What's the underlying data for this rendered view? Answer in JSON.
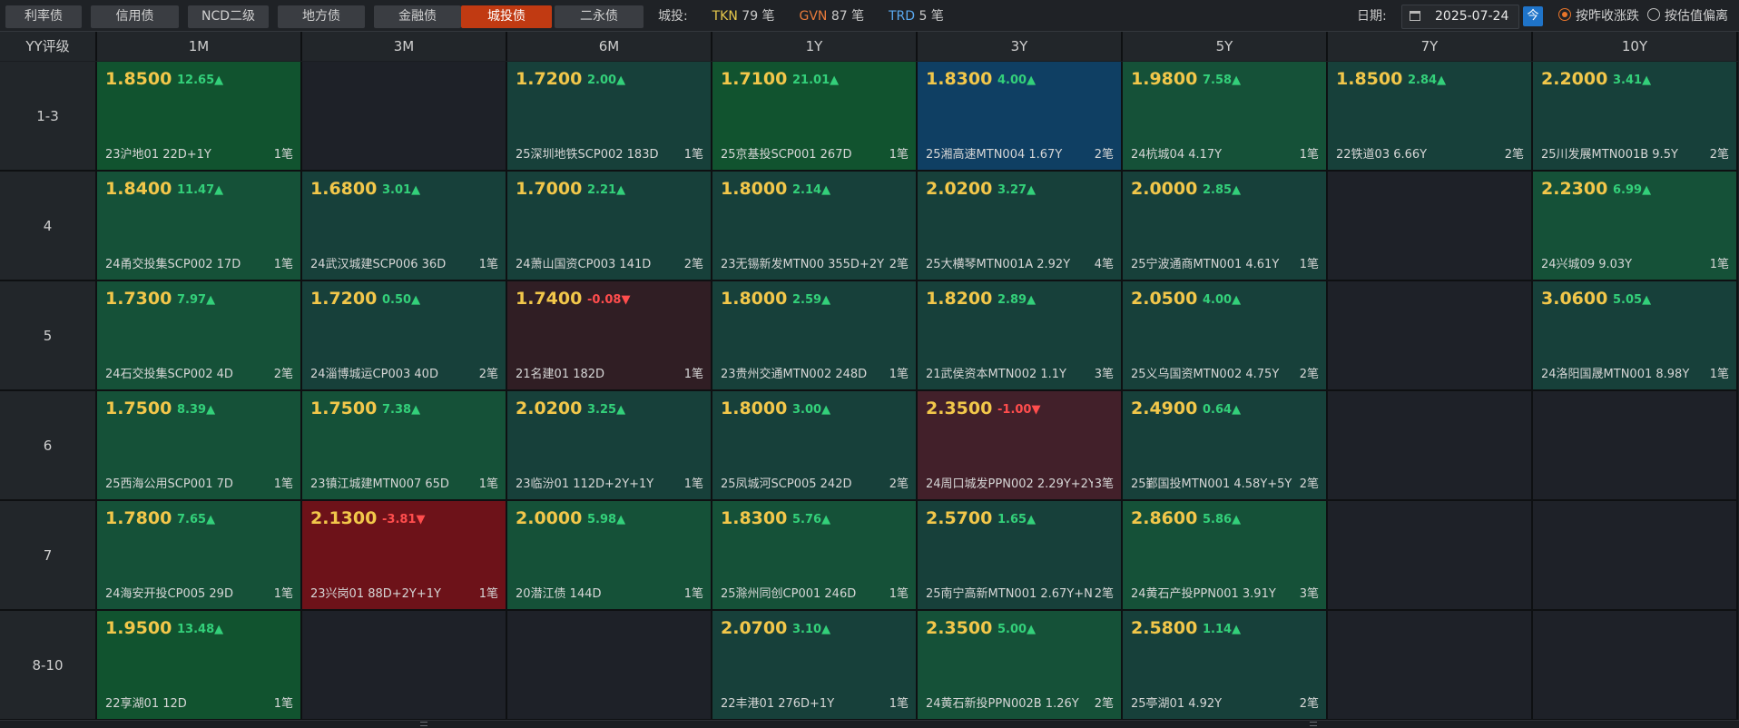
{
  "tabs": [
    {
      "label": "利率债",
      "active": false
    },
    {
      "label": "信用债",
      "active": false
    },
    {
      "label": "NCD二级",
      "active": false
    },
    {
      "label": "地方债",
      "active": false
    },
    {
      "label": "金融债",
      "active": false
    },
    {
      "label": "城投债",
      "active": true
    },
    {
      "label": "二永债",
      "active": false
    }
  ],
  "stats": {
    "label": "城投:",
    "tkn_code": "TKN",
    "tkn_value": "79 笔",
    "gvn_code": "GVN",
    "gvn_value": "87 笔",
    "trd_code": "TRD",
    "trd_value": "5 笔"
  },
  "date": {
    "label": "日期:",
    "value": "2025-07-24",
    "today_label": "今"
  },
  "sort_options": [
    {
      "label": "按昨收涨跌",
      "selected": true
    },
    {
      "label": "按估值偏离",
      "selected": false
    }
  ],
  "colors": {
    "green_bright": "#11532f",
    "green_mid": "#155138",
    "green_dark": "#17403a",
    "blue": "#0f3f63",
    "red_bright": "#6d1219",
    "red_dark": "#42202a",
    "red_muted": "#301e24",
    "empty": "#1e2128"
  },
  "grid": {
    "corner_label": "YY评级",
    "columns": [
      "1M",
      "3M",
      "6M",
      "1Y",
      "3Y",
      "5Y",
      "7Y",
      "10Y"
    ],
    "rows": [
      {
        "label": "1-3",
        "cells": [
          {
            "yield": "1.8500",
            "change": "12.65▲",
            "dir": "up",
            "bond": "23沪地01 22D+1Y",
            "count": "1笔",
            "color": "green_bright"
          },
          null,
          {
            "yield": "1.7200",
            "change": "2.00▲",
            "dir": "up",
            "bond": "25深圳地铁SCP002 183D",
            "count": "1笔",
            "color": "green_dark"
          },
          {
            "yield": "1.7100",
            "change": "21.01▲",
            "dir": "up",
            "bond": "25京基投SCP001 267D",
            "count": "1笔",
            "color": "green_bright"
          },
          {
            "yield": "1.8300",
            "change": "4.00▲",
            "dir": "up",
            "bond": "25湘高速MTN004 1.67Y",
            "count": "2笔",
            "color": "blue"
          },
          {
            "yield": "1.9800",
            "change": "7.58▲",
            "dir": "up",
            "bond": "24杭城04 4.17Y",
            "count": "1笔",
            "color": "green_mid"
          },
          {
            "yield": "1.8500",
            "change": "2.84▲",
            "dir": "up",
            "bond": "22铁道03 6.66Y",
            "count": "2笔",
            "color": "green_dark"
          },
          {
            "yield": "2.2000",
            "change": "3.41▲",
            "dir": "up",
            "bond": "25川发展MTN001B 9.5Y",
            "count": "2笔",
            "color": "green_dark"
          }
        ]
      },
      {
        "label": "4",
        "cells": [
          {
            "yield": "1.8400",
            "change": "11.47▲",
            "dir": "up",
            "bond": "24甬交投集SCP002 17D",
            "count": "1笔",
            "color": "green_mid"
          },
          {
            "yield": "1.6800",
            "change": "3.01▲",
            "dir": "up",
            "bond": "24武汉城建SCP006 36D",
            "count": "1笔",
            "color": "green_dark"
          },
          {
            "yield": "1.7000",
            "change": "2.21▲",
            "dir": "up",
            "bond": "24萧山国资CP003 141D",
            "count": "2笔",
            "color": "green_dark"
          },
          {
            "yield": "1.8000",
            "change": "2.14▲",
            "dir": "up",
            "bond": "23无锡新发MTN00 355D+2Y",
            "count": "2笔",
            "color": "green_dark"
          },
          {
            "yield": "2.0200",
            "change": "3.27▲",
            "dir": "up",
            "bond": "25大横琴MTN001A 2.92Y",
            "count": "4笔",
            "color": "green_dark"
          },
          {
            "yield": "2.0000",
            "change": "2.85▲",
            "dir": "up",
            "bond": "25宁波通商MTN001 4.61Y",
            "count": "1笔",
            "color": "green_dark"
          },
          null,
          {
            "yield": "2.2300",
            "change": "6.99▲",
            "dir": "up",
            "bond": "24兴城09 9.03Y",
            "count": "1笔",
            "color": "green_mid"
          }
        ]
      },
      {
        "label": "5",
        "cells": [
          {
            "yield": "1.7300",
            "change": "7.97▲",
            "dir": "up",
            "bond": "24石交投集SCP002 4D",
            "count": "2笔",
            "color": "green_mid"
          },
          {
            "yield": "1.7200",
            "change": "0.50▲",
            "dir": "up",
            "bond": "24淄博城运CP003 40D",
            "count": "2笔",
            "color": "green_dark"
          },
          {
            "yield": "1.7400",
            "change": "-0.08▼",
            "dir": "down",
            "bond": "21名建01 182D",
            "count": "1笔",
            "color": "red_muted"
          },
          {
            "yield": "1.8000",
            "change": "2.59▲",
            "dir": "up",
            "bond": "23贵州交通MTN002 248D",
            "count": "1笔",
            "color": "green_dark"
          },
          {
            "yield": "1.8200",
            "change": "2.89▲",
            "dir": "up",
            "bond": "21武侯资本MTN002 1.1Y",
            "count": "3笔",
            "color": "green_dark"
          },
          {
            "yield": "2.0500",
            "change": "4.00▲",
            "dir": "up",
            "bond": "25义乌国资MTN002 4.75Y",
            "count": "2笔",
            "color": "green_dark"
          },
          null,
          {
            "yield": "3.0600",
            "change": "5.05▲",
            "dir": "up",
            "bond": "24洛阳国晟MTN001 8.98Y",
            "count": "1笔",
            "color": "green_dark"
          }
        ]
      },
      {
        "label": "6",
        "cells": [
          {
            "yield": "1.7500",
            "change": "8.39▲",
            "dir": "up",
            "bond": "25西海公用SCP001 7D",
            "count": "1笔",
            "color": "green_mid"
          },
          {
            "yield": "1.7500",
            "change": "7.38▲",
            "dir": "up",
            "bond": "23镇江城建MTN007 65D",
            "count": "1笔",
            "color": "green_mid"
          },
          {
            "yield": "2.0200",
            "change": "3.25▲",
            "dir": "up",
            "bond": "23临汾01 112D+2Y+1Y",
            "count": "1笔",
            "color": "green_dark"
          },
          {
            "yield": "1.8000",
            "change": "3.00▲",
            "dir": "up",
            "bond": "25凤城河SCP005 242D",
            "count": "2笔",
            "color": "green_dark"
          },
          {
            "yield": "2.3500",
            "change": "-1.00▼",
            "dir": "down",
            "bond": "24周口城发PPN002 2.29Y+2Y",
            "count": "3笔",
            "color": "red_dark"
          },
          {
            "yield": "2.4900",
            "change": "0.64▲",
            "dir": "up",
            "bond": "25鄞国投MTN001 4.58Y+5Y",
            "count": "2笔",
            "color": "green_dark"
          },
          null,
          null
        ]
      },
      {
        "label": "7",
        "cells": [
          {
            "yield": "1.7800",
            "change": "7.65▲",
            "dir": "up",
            "bond": "24海安开投CP005 29D",
            "count": "1笔",
            "color": "green_mid"
          },
          {
            "yield": "2.1300",
            "change": "-3.81▼",
            "dir": "down",
            "bond": "23兴岗01 88D+2Y+1Y",
            "count": "1笔",
            "color": "red_bright"
          },
          {
            "yield": "2.0000",
            "change": "5.98▲",
            "dir": "up",
            "bond": "20潜江债 144D",
            "count": "1笔",
            "color": "green_mid"
          },
          {
            "yield": "1.8300",
            "change": "5.76▲",
            "dir": "up",
            "bond": "25滁州同创CP001 246D",
            "count": "1笔",
            "color": "green_mid"
          },
          {
            "yield": "2.5700",
            "change": "1.65▲",
            "dir": "up",
            "bond": "25南宁高新MTN001 2.67Y+N",
            "count": "2笔",
            "color": "green_dark"
          },
          {
            "yield": "2.8600",
            "change": "5.86▲",
            "dir": "up",
            "bond": "24黄石产投PPN001 3.91Y",
            "count": "3笔",
            "color": "green_mid"
          },
          null,
          null
        ]
      },
      {
        "label": "8-10",
        "cells": [
          {
            "yield": "1.9500",
            "change": "13.48▲",
            "dir": "up",
            "bond": "22享湖01 12D",
            "count": "1笔",
            "color": "green_bright"
          },
          null,
          null,
          {
            "yield": "2.0700",
            "change": "3.10▲",
            "dir": "up",
            "bond": "22丰港01 276D+1Y",
            "count": "1笔",
            "color": "green_dark"
          },
          {
            "yield": "2.3500",
            "change": "5.00▲",
            "dir": "up",
            "bond": "24黄石新投PPN002B 1.26Y",
            "count": "2笔",
            "color": "green_mid"
          },
          {
            "yield": "2.5800",
            "change": "1.14▲",
            "dir": "up",
            "bond": "25亭湖01 4.92Y",
            "count": "2笔",
            "color": "green_dark"
          },
          null,
          null
        ]
      }
    ]
  }
}
